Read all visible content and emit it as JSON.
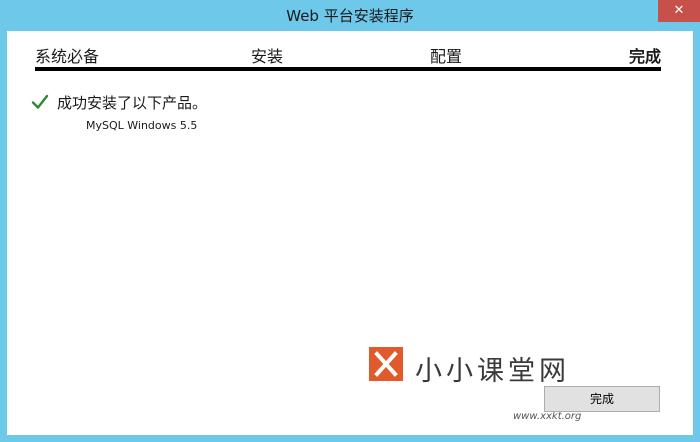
{
  "window": {
    "title": "Web 平台安装程序",
    "close_glyph": "✕"
  },
  "steps": [
    {
      "label": "系统必备",
      "current": false
    },
    {
      "label": "安装",
      "current": false
    },
    {
      "label": "配置",
      "current": false
    },
    {
      "label": "完成",
      "current": true
    }
  ],
  "status": {
    "icon": "check-icon",
    "message": "成功安装了以下产品。",
    "products": [
      "MySQL Windows 5.5"
    ]
  },
  "watermark": {
    "text": "小小课堂网",
    "url": "www.xxkt.org"
  },
  "buttons": {
    "finish": "完成"
  },
  "colors": {
    "titlebar": "#6ec8ea",
    "check": "#2e8b2e",
    "close": "#c7504b",
    "watermark_logo": "#e05a2b"
  }
}
